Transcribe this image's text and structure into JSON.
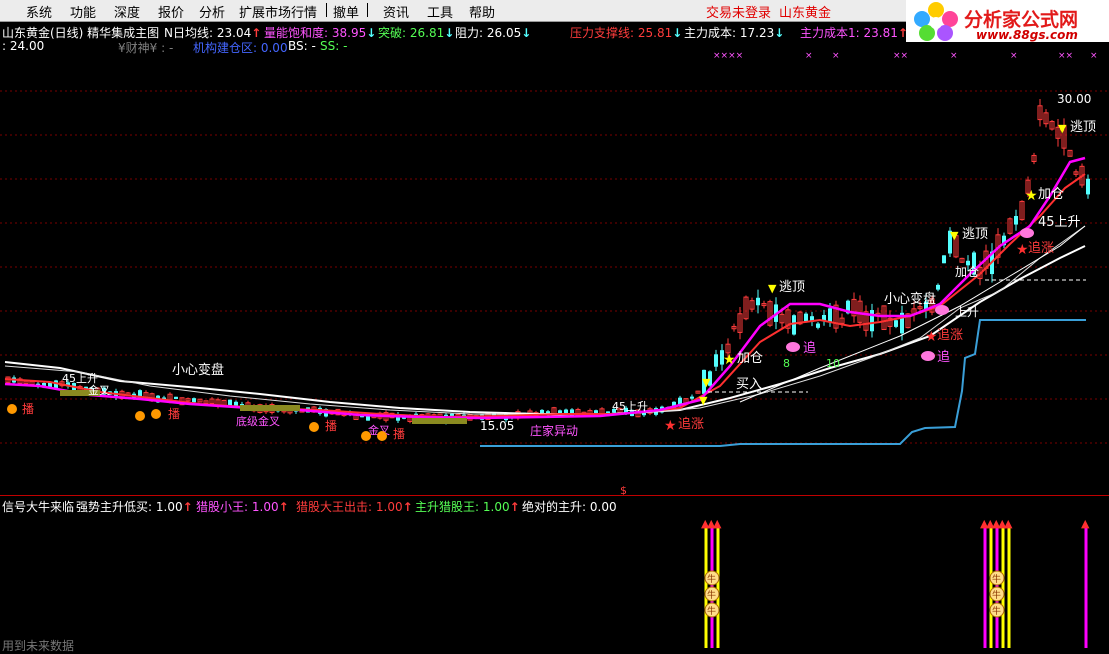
{
  "menu": {
    "items": [
      "系统",
      "功能",
      "深度",
      "报价",
      "分析",
      "扩展市场行情",
      "撤单",
      "资讯",
      "工具",
      "帮助"
    ],
    "login_status": "交易未登录",
    "stock_name": "山东黄金"
  },
  "logo": {
    "title": "分析家公式网",
    "url": "www.88gs.com"
  },
  "header1": {
    "title": "山东黄金(日线) 精华集成主图",
    "n_ma_label": "N日均线:",
    "n_ma_value": "23.04",
    "saturation_label": "量能饱和度:",
    "saturation_value": "38.95",
    "breakout_label": "突破:",
    "breakout_value": "26.81",
    "resistance_label": "阻力:",
    "resistance_value": "26.05",
    "support_label": "压力支撑线:",
    "support_value": "25.81",
    "cost_label": "主力成本:",
    "cost_value": "17.23",
    "cost1_label": "主力成本1:",
    "cost1_value": "23.81"
  },
  "header2": {
    "value1": ": 24.00",
    "wealth_label": "¥财神¥ : -",
    "inst_label": "机构建仓区: 0.00",
    "bs_label": "BS: -",
    "ss_label": "SS: -"
  },
  "chart_labels": {
    "price_high": "30.00",
    "price_low": "15.05",
    "escape_top_1": "逃顶",
    "escape_top_2": "逃顶",
    "escape_top_3": "逃顶",
    "add_pos_1": "加仓",
    "add_pos_2": "加仓",
    "add_pos_3": "加仓",
    "rise45_1": "45上升",
    "rise45_2": "45上升",
    "rise45_3": "45上升",
    "rise": "上升",
    "careful_1": "小心变盘",
    "careful_2": "小心变盘",
    "chase_1": "追涨",
    "chase_2": "追涨",
    "chase_3": "追涨",
    "chase_short_1": "追",
    "chase_short_2": "追",
    "buy_in": "买入",
    "zhuang": "庄家异动",
    "seed": "播",
    "gold_cross": "金叉",
    "bottom_gold": "底级金叉",
    "num8": "8",
    "num10": "10",
    "dollar": "$"
  },
  "sub": {
    "signal_label": "信号大牛来临",
    "strong_label": "强势主升低买:",
    "strong_value": "1.00",
    "cat_small_label": "猎股小王:",
    "cat_small_value": "1.00",
    "cat_king_out_label": "猎股大王出击:",
    "cat_king_out_value": "1.00",
    "main_rise_label": "主升猎股王:",
    "main_rise_value": "1.00",
    "absolute_label": "绝对的主升:",
    "absolute_value": "0.00",
    "coin_glyph": "牛"
  },
  "status_text": "用到未来数据",
  "colors": {
    "up": "#ff3c3c",
    "down": "#54ffff",
    "ma_magenta": "#ff00ff",
    "ma_red": "#ff3030",
    "white_line": "#ffffff",
    "step_line": "#3a9fd8",
    "grid": "#7a0000",
    "yellow": "#ffff00"
  }
}
